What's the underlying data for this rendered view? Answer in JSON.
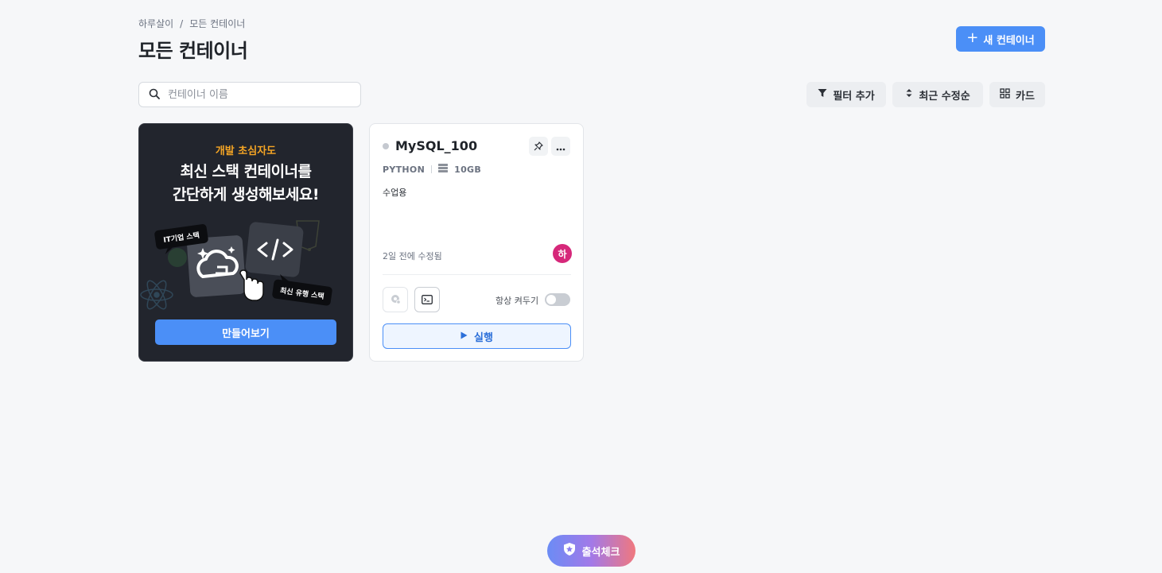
{
  "breadcrumb": {
    "root": "하루살이",
    "separator": "/",
    "current": "모든 컨테이너"
  },
  "page_title": "모든 컨테이너",
  "new_container_label": "새 컨테이너",
  "search": {
    "placeholder": "컨테이너 이름",
    "value": ""
  },
  "toolbar": {
    "filter_label": "필터 추가",
    "sort_label": "최근 수정순",
    "view_label": "카드"
  },
  "promo": {
    "eyebrow": "개발 초심자도",
    "title_line1": "최신 스택 컨테이너를",
    "title_line2": "간단하게 생성해보세요!",
    "tag_it": "IT기업 스택",
    "tag_latest": "최신 유행 스택",
    "button_label": "만들어보기"
  },
  "container_card": {
    "name": "MySQL_100",
    "stack": "PYTHON",
    "storage": "10GB",
    "description": "수업용",
    "updated": "2일 전에 수정됨",
    "avatar_initial": "하",
    "always_on_label": "항상 켜두기",
    "always_on": false,
    "run_label": "실행"
  },
  "checkin_label": "출석체크",
  "colors": {
    "accent": "#4b8ff7",
    "promo_bg": "#22252d",
    "eyebrow": "#f5a524",
    "avatar": "#d6287a"
  }
}
